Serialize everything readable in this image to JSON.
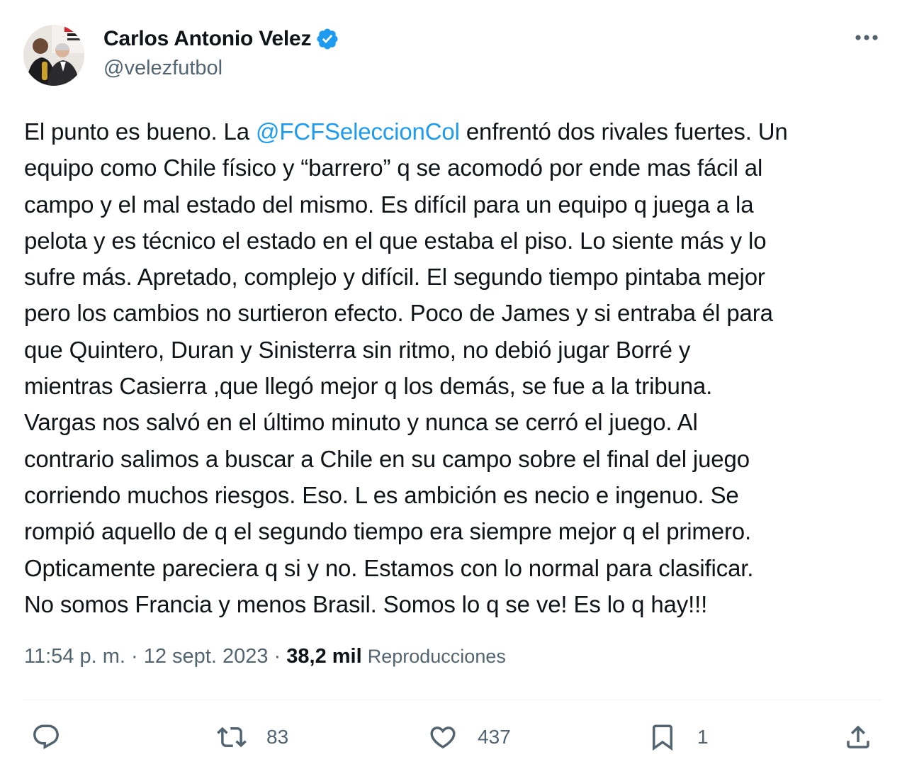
{
  "author": {
    "display_name": "Carlos Antonio Velez",
    "handle": "@velezfutbol",
    "verified": true,
    "verified_color": "#1d9bf0"
  },
  "tweet": {
    "lines": [
      [
        {
          "text": "El punto es bueno. La "
        },
        {
          "text": "@FCFSeleccionCol",
          "mention": true
        },
        {
          "text": " enfrentó dos rivales fuertes. Un"
        }
      ],
      [
        {
          "text": "equipo como Chile físico y “barrero” q se acomodó por ende mas fácil al"
        }
      ],
      [
        {
          "text": "campo y el mal estado del mismo. Es difícil para un equipo q juega a la"
        }
      ],
      [
        {
          "text": "pelota y es técnico el estado en el que estaba el piso. Lo siente más y lo"
        }
      ],
      [
        {
          "text": "sufre más. Apretado, complejo y difícil. El segundo tiempo pintaba mejor"
        }
      ],
      [
        {
          "text": "pero los cambios no surtieron efecto. Poco de James y si entraba él para"
        }
      ],
      [
        {
          "text": "que Quintero, Duran y Sinisterra sin ritmo, no debió jugar Borré y"
        }
      ],
      [
        {
          "text": "mientras Casierra ,que llegó mejor q los demás, se fue a la tribuna."
        }
      ],
      [
        {
          "text": "Vargas nos salvó en el último minuto y nunca se cerró el juego. Al"
        }
      ],
      [
        {
          "text": "contrario salimos a buscar a Chile en su campo sobre el final del juego"
        }
      ],
      [
        {
          "text": "corriendo muchos riesgos. Eso. L es ambición es necio e ingenuo. Se"
        }
      ],
      [
        {
          "text": "rompió aquello de q el segundo tiempo era siempre mejor q el primero."
        }
      ],
      [
        {
          "text": "Opticamente pareciera q si y no. Estamos con lo normal para clasificar."
        }
      ],
      [
        {
          "text": "No somos Francia y menos Brasil. Somos lo q se ve! Es lo q hay!!!"
        }
      ]
    ]
  },
  "meta": {
    "time": "11:54 p. m.",
    "separator": " · ",
    "date": "12 sept. 2023",
    "views_count": "38,2 mil",
    "views_label": "Reproducciones"
  },
  "actions": {
    "reply": {
      "icon": "reply-icon",
      "count": ""
    },
    "retweet": {
      "icon": "retweet-icon",
      "count": "83"
    },
    "like": {
      "icon": "heart-icon",
      "count": "437"
    },
    "bookmark": {
      "icon": "bookmark-icon",
      "count": "1"
    },
    "share": {
      "icon": "share-icon"
    }
  },
  "colors": {
    "accent": "#1d9bf0",
    "text": "#0f1419",
    "secondary": "#536471",
    "divider": "#eff3f4"
  }
}
